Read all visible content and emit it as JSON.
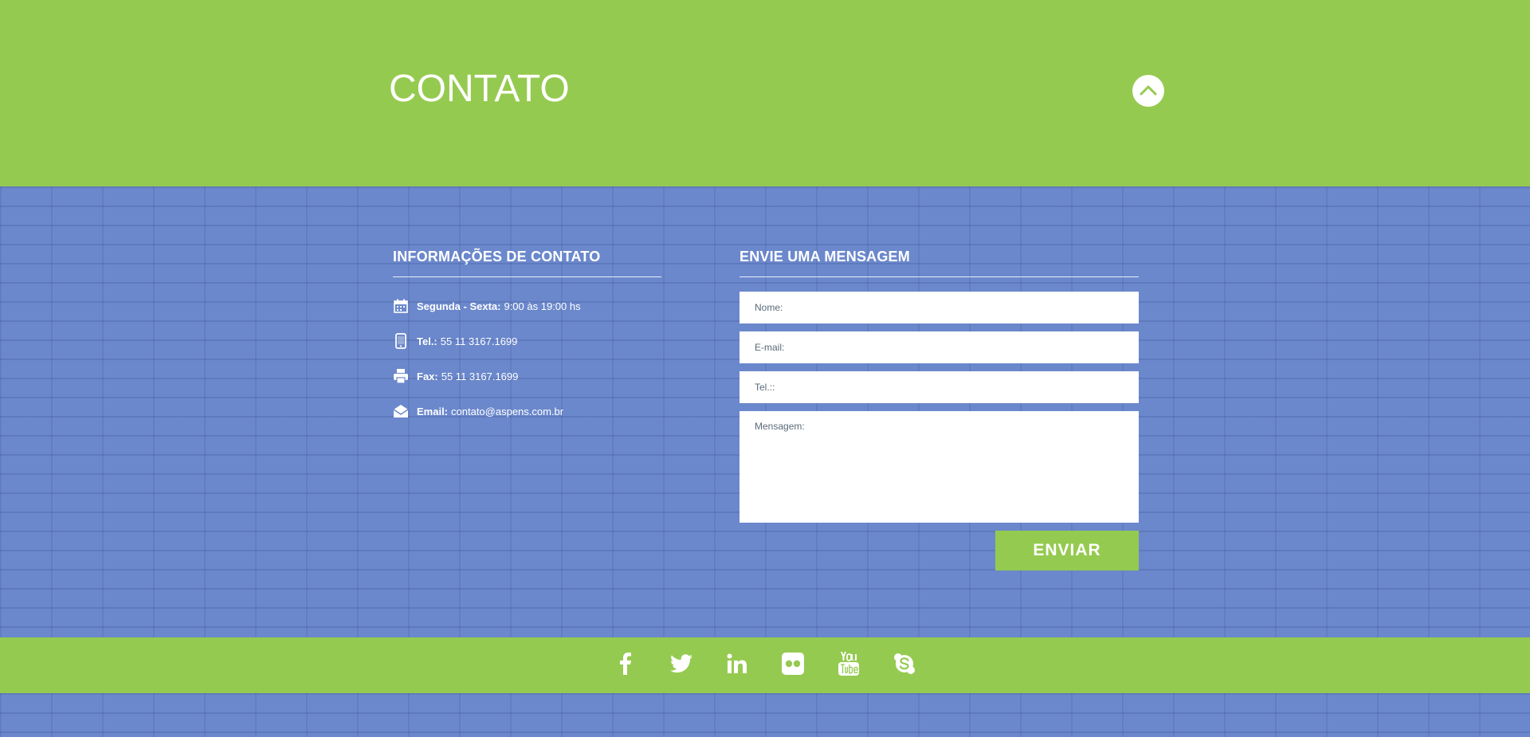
{
  "header": {
    "title": "CONTATO",
    "scroll_up_icon": "chevron-up-icon"
  },
  "info": {
    "heading": "INFORMAÇÕES DE CONTATO",
    "items": [
      {
        "icon": "calendar-icon",
        "label": "Segunda - Sexta:",
        "value": "9:00 às 19:00 hs"
      },
      {
        "icon": "phone-icon",
        "label": "Tel.:",
        "value": "55 11 3167.1699"
      },
      {
        "icon": "printer-icon",
        "label": "Fax:",
        "value": "55 11 3167.1699"
      },
      {
        "icon": "envelope-icon",
        "label": "Email:",
        "value": "contato@aspens.com.br"
      }
    ]
  },
  "form": {
    "heading": "ENVIE UMA MENSAGEM",
    "name_placeholder": "Nome:",
    "email_placeholder": "E-mail:",
    "phone_placeholder": "Tel.::",
    "message_placeholder": "Mensagem:",
    "submit_label": "ENVIAR"
  },
  "social": [
    "facebook-icon",
    "twitter-icon",
    "linkedin-icon",
    "flickr-icon",
    "youtube-icon",
    "skype-icon"
  ],
  "colors": {
    "green": "#95ca50",
    "blue": "#6b88cc",
    "white": "#ffffff"
  }
}
